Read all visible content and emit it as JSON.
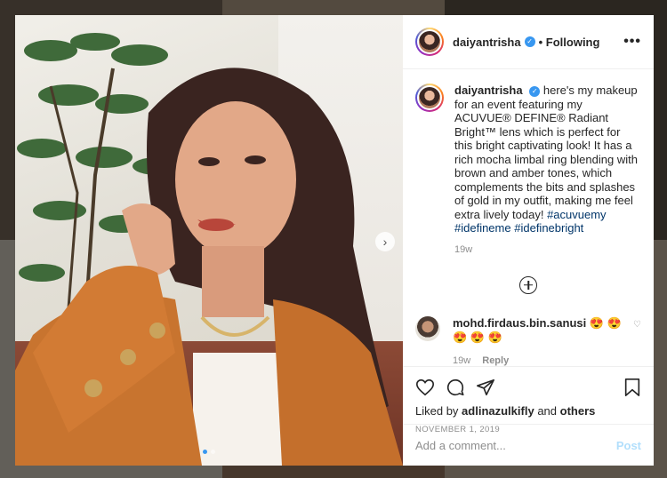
{
  "post": {
    "username": "daiyantrisha",
    "follow_status": "Following",
    "dot_separator": "•",
    "verified_mark": "✓",
    "more_glyph": "•••",
    "caption_text": "here's my makeup for an event featuring my ACUVUE® DEFINE® Radiant Bright™ lens which is perfect for this bright captivating look! It has a rich mocha limbal ring blending with brown and amber tones, which complements the bits and splashes of gold in my outfit, making me feel extra lively today!",
    "hashtags": [
      "#acuvuemy",
      "#idefineme",
      "#idefinebright"
    ],
    "caption_time": "19w",
    "date": "NOVEMBER 1, 2019",
    "liked_by_prefix": "Liked by",
    "liked_by_user": "adlinazulkifly",
    "liked_by_and": "and",
    "liked_by_others": "others",
    "carousel_index": 1,
    "carousel_total": 2
  },
  "comments": [
    {
      "username": "mohd.firdaus.bin.sanusi",
      "text": "😍 😍 😍 😍 😍",
      "time": "19w",
      "reply_label": "Reply",
      "heart_glyph": "♡"
    }
  ],
  "add_comment": {
    "placeholder": "Add a comment...",
    "post_label": "Post"
  },
  "icons": {
    "like": "heart-icon",
    "comment": "comment-icon",
    "share": "paper-plane-icon",
    "save": "bookmark-icon",
    "load_more": "plus-circle-icon",
    "next": "chevron-right-icon"
  },
  "colors": {
    "link": "#003569",
    "verified": "#3897f0",
    "post_disabled": "#b2dffc",
    "muted": "#8e8e8e"
  }
}
